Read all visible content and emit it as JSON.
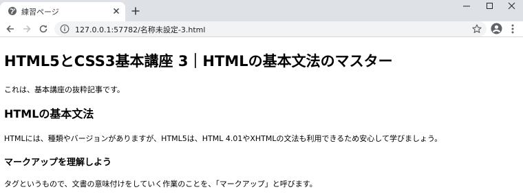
{
  "browser": {
    "tab": {
      "title": "練習ページ",
      "favicon": "globe-icon"
    },
    "address_bar": {
      "url": "127.0.0.1:57782/名称未設定-3.html"
    },
    "icons": {
      "back": "arrow-left-icon",
      "forward": "arrow-right-icon",
      "reload": "reload-icon",
      "info": "info-icon",
      "bookmark": "star-icon",
      "profile": "account-icon",
      "menu": "kebab-menu-icon",
      "new_tab": "plus-icon",
      "minimize": "minimize-icon",
      "maximize": "maximize-icon",
      "close": "close-icon"
    },
    "colors": {
      "tabstrip": "#dee1e6",
      "omnibox": "#f1f3f4",
      "icon": "#5f6368"
    }
  },
  "page": {
    "h1": "HTML5とCSS3基本講座 3｜HTMLの基本文法のマスター",
    "intro": "これは、基本講座の抜粋記事です。",
    "h2": "HTMLの基本文法",
    "paragraph": "HTMLには、種類やバージョンがありますが、HTML5は、HTML 4.01やXHTMLの文法も利用できるため安心して学びましょう。",
    "h3": "マークアップを理解しよう",
    "paragraph2": "タグというもので、文書の意味付けをしていく作業のことを、「マークアップ」と呼びます。"
  }
}
